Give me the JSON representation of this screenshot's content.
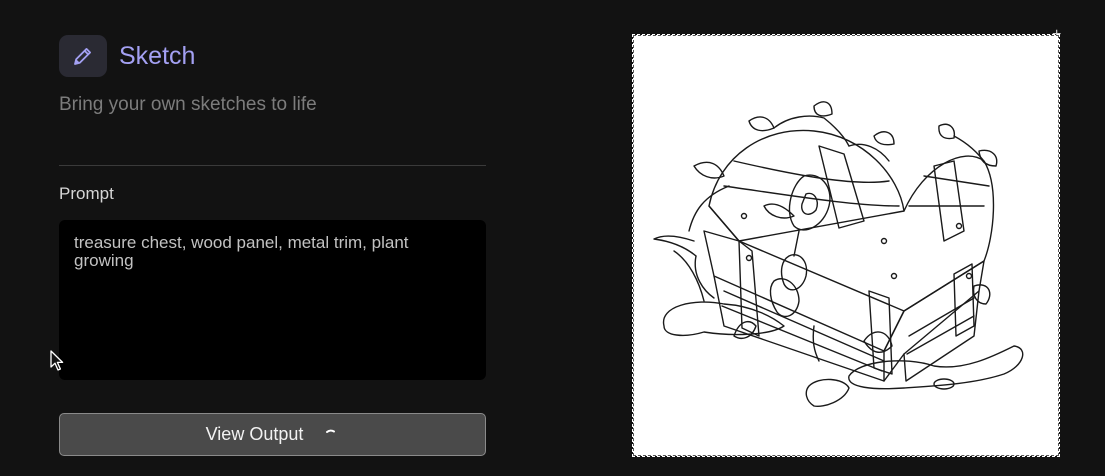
{
  "header": {
    "icon": "pencil-icon",
    "title": "Sketch",
    "subtitle": "Bring your own sketches to life"
  },
  "prompt": {
    "label": "Prompt",
    "value": "treasure chest, wood panel, metal trim, plant growing"
  },
  "actions": {
    "view_output_label": "View Output",
    "loading": true
  },
  "canvas": {
    "image": "treasure chest sketch with plants"
  },
  "colors": {
    "background": "#121212",
    "accent": "#a3a0f2",
    "prompt_background": "#000000",
    "button_background": "#4a4a4a"
  }
}
